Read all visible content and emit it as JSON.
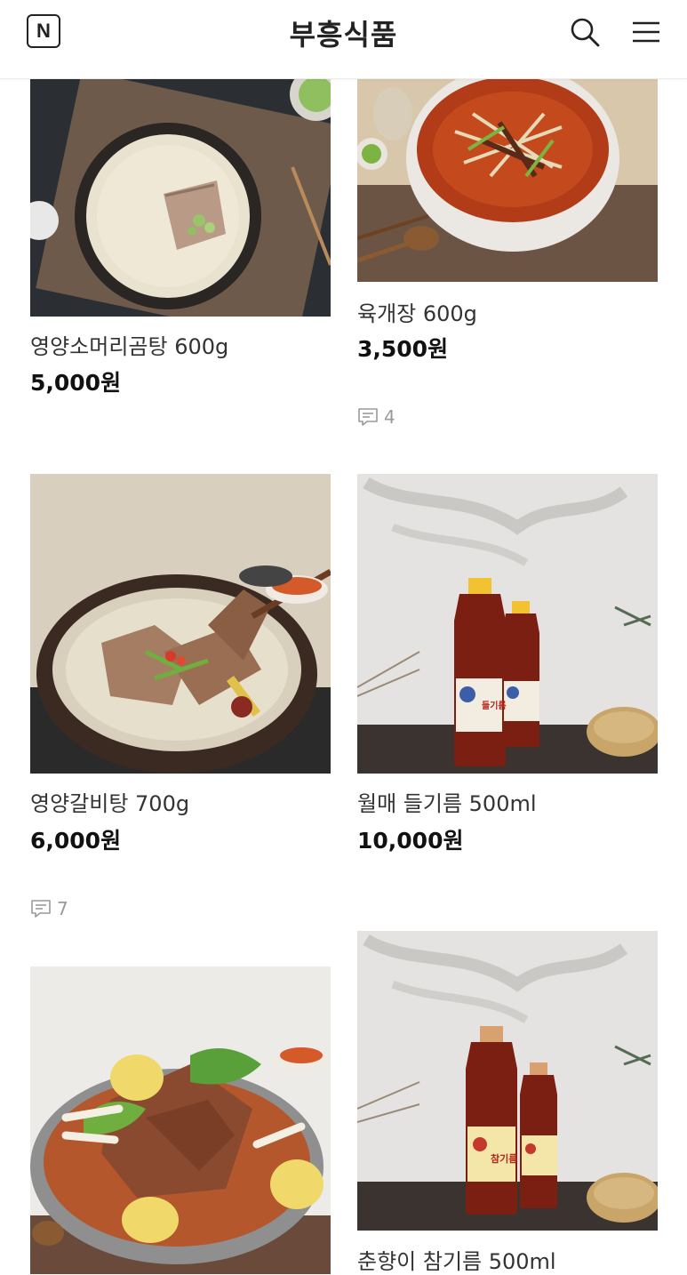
{
  "header": {
    "logo_letter": "N",
    "store_name": "부흥식품",
    "icons": {
      "search": "search-icon",
      "menu": "hamburger-menu-icon"
    }
  },
  "products": [
    {
      "name": "영양소머리곰탕 600g",
      "price": "5,000원",
      "reviews": ""
    },
    {
      "name": "육개장 600g",
      "price": "3,500원",
      "reviews": "4"
    },
    {
      "name": "영양갈비탕 700g",
      "price": "6,000원",
      "reviews": "7"
    },
    {
      "name": "월매 들기름 500ml",
      "price": "10,000원",
      "reviews": ""
    },
    {
      "name": "",
      "price": "",
      "reviews": ""
    },
    {
      "name": "춘향이 참기름 500ml",
      "price": "",
      "reviews": ""
    }
  ],
  "bottle_labels": {
    "perilla": "들기름",
    "sesame": "참기름"
  }
}
